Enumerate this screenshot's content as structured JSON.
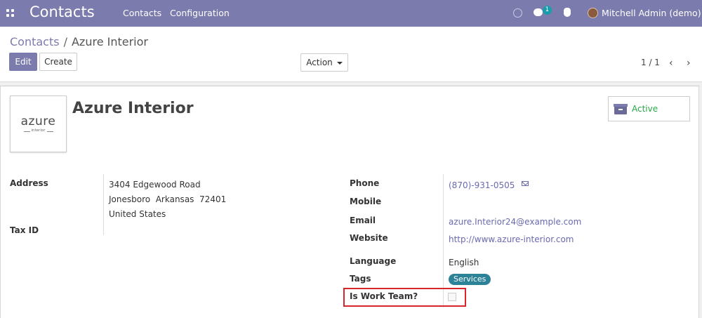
{
  "navbar": {
    "app_title": "Contacts",
    "menu": [
      "Contacts",
      "Configuration"
    ],
    "chat_count": "1",
    "user": "Mitchell Admin (demo)",
    "bg_color": "#7c7bad"
  },
  "breadcrumb": {
    "parent": "Contacts",
    "separator": "/",
    "current": "Azure Interior"
  },
  "toolbar": {
    "edit_label": "Edit",
    "create_label": "Create",
    "action_label": "Action"
  },
  "pager": {
    "value": "1 / 1",
    "prev_icon": "chevron-left-icon",
    "next_icon": "chevron-right-icon",
    "prev_glyph": "‹",
    "next_glyph": "›"
  },
  "record": {
    "logo_word": "azure",
    "logo_sub": "interior",
    "name": "Azure Interior",
    "status_label": "Active",
    "status_color": "#28a745"
  },
  "fields": {
    "address_label": "Address",
    "address_line1": "3404 Edgewood Road",
    "address_line2": "Jonesboro  Arkansas  72401",
    "address_line3": "United States",
    "taxid_label": "Tax ID",
    "phone_label": "Phone",
    "phone_value": "(870)-931-0505",
    "mobile_label": "Mobile",
    "email_label": "Email",
    "email_value": "azure.Interior24@example.com",
    "website_label": "Website",
    "website_value": "http://www.azure-interior.com",
    "language_label": "Language",
    "language_value": "English",
    "tags_label": "Tags",
    "tag_value": "Services",
    "workteam_label": "Is Work Team?",
    "workteam_checked": false
  }
}
